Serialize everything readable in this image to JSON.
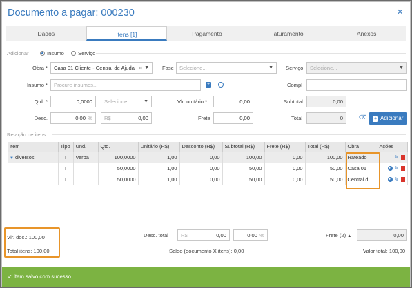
{
  "header": {
    "title": "Documento a pagar: 000230",
    "close_icon": "×"
  },
  "tabs": [
    {
      "label": "Dados"
    },
    {
      "label": "Itens [1]"
    },
    {
      "label": "Pagamento"
    },
    {
      "label": "Faturamento"
    },
    {
      "label": "Anexos"
    }
  ],
  "form": {
    "adicionar_label": "Adicionar",
    "radio_insumo": "Insumo",
    "radio_servico": "Serviço",
    "obra_label": "Obra *",
    "obra_value": "Casa 01 Cliente - Central de Ajuda",
    "obra_clear": "×",
    "fase_label": "Fase",
    "fase_placeholder": "Selecione...",
    "servico_label": "Serviço",
    "servico_placeholder": "Selecione...",
    "insumo_label": "Insumo *",
    "insumo_placeholder": "Procure insumos...",
    "compl_label": "Compl",
    "qtd_label": "Qtd. *",
    "qtd_value": "0,0000",
    "unit_placeholder": "Selecione...",
    "vlr_unit_label": "Vlr. unitário *",
    "vlr_unit_value": "0,00",
    "subtotal_label": "Subtotal",
    "subtotal_value": "0,00",
    "desc_label": "Desc.",
    "desc_pct_value": "0,00",
    "desc_pct_suffix": "%",
    "desc_rs_prefix": "R$",
    "desc_rs_value": "0,00",
    "frete_label": "Frete",
    "frete_value": "0,00",
    "total_label": "Total",
    "total_value": "0",
    "add_button": "Adicionar"
  },
  "items": {
    "section_label": "Relação de itens",
    "columns": [
      "Item",
      "Tipo",
      "Und.",
      "Qtd.",
      "Unitário (R$)",
      "Desconto (R$)",
      "Subtotal (R$)",
      "Frete (R$)",
      "Total (R$)",
      "Obra",
      "Ações"
    ],
    "rows": [
      {
        "item": "diversos",
        "tipo": "I",
        "und": "Verba",
        "qtd": "100,0000",
        "unit": "1,00",
        "desc": "0,00",
        "sub": "100,00",
        "frete": "0,00",
        "total": "100,00",
        "obra": "Rateado"
      },
      {
        "item": "",
        "tipo": "I",
        "und": "",
        "qtd": "50,0000",
        "unit": "1,00",
        "desc": "0,00",
        "sub": "50,00",
        "frete": "0,00",
        "total": "50,00",
        "obra": "Casa 01"
      },
      {
        "item": "",
        "tipo": "I",
        "und": "",
        "qtd": "50,0000",
        "unit": "1,00",
        "desc": "0,00",
        "sub": "50,00",
        "frete": "0,00",
        "total": "50,00",
        "obra": "Central d..."
      }
    ]
  },
  "footer": {
    "vlr_doc": "Vlr. doc.: 100,00",
    "total_itens": "Total itens: 100,00",
    "desc_total_label": "Desc. total",
    "desc_total_prefix": "R$",
    "desc_total_value": "0,00",
    "desc_total_pct": "0,00",
    "desc_total_pct_suffix": "%",
    "saldo": "Saldo (documento X itens): 0,00",
    "frete_label": "Frete (2)",
    "frete_value": "0,00",
    "valor_total": "Valor total: 100,00"
  },
  "toast": {
    "message": "Item salvo com sucesso."
  },
  "colors": {
    "accent": "#3a7bbf",
    "success": "#7cb342",
    "highlight": "#e8952a",
    "danger": "#d9342b"
  }
}
